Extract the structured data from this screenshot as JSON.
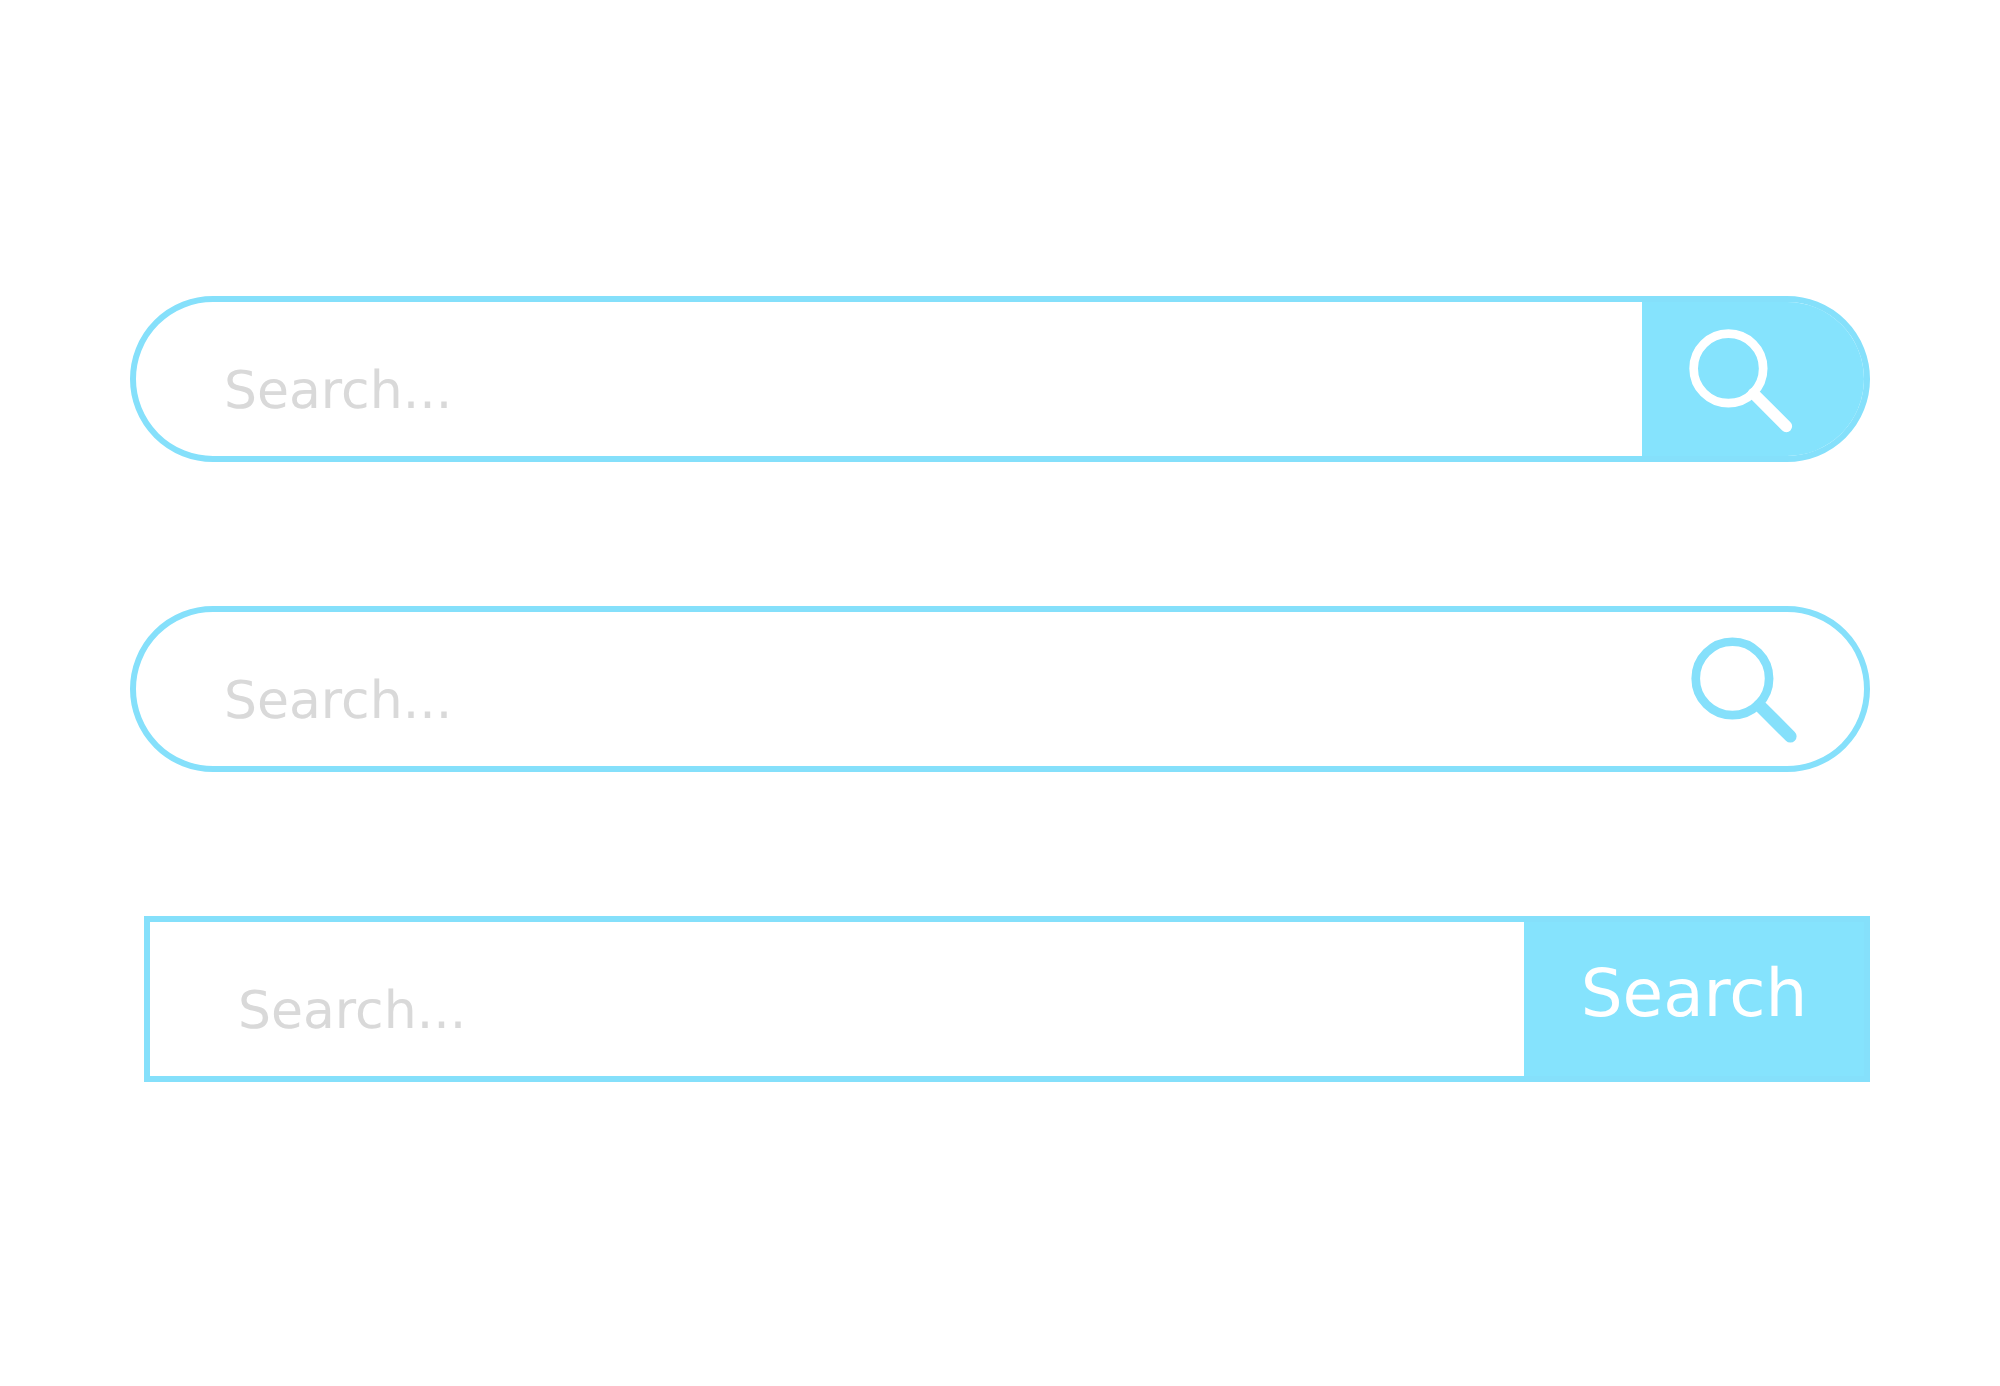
{
  "search_bars": [
    {
      "kind": "iconbutton",
      "placeholder": "Search..."
    },
    {
      "kind": "inlineicon",
      "placeholder": "Search..."
    },
    {
      "kind": "textbutton",
      "placeholder": "Search...",
      "button_label": "Search"
    }
  ]
}
